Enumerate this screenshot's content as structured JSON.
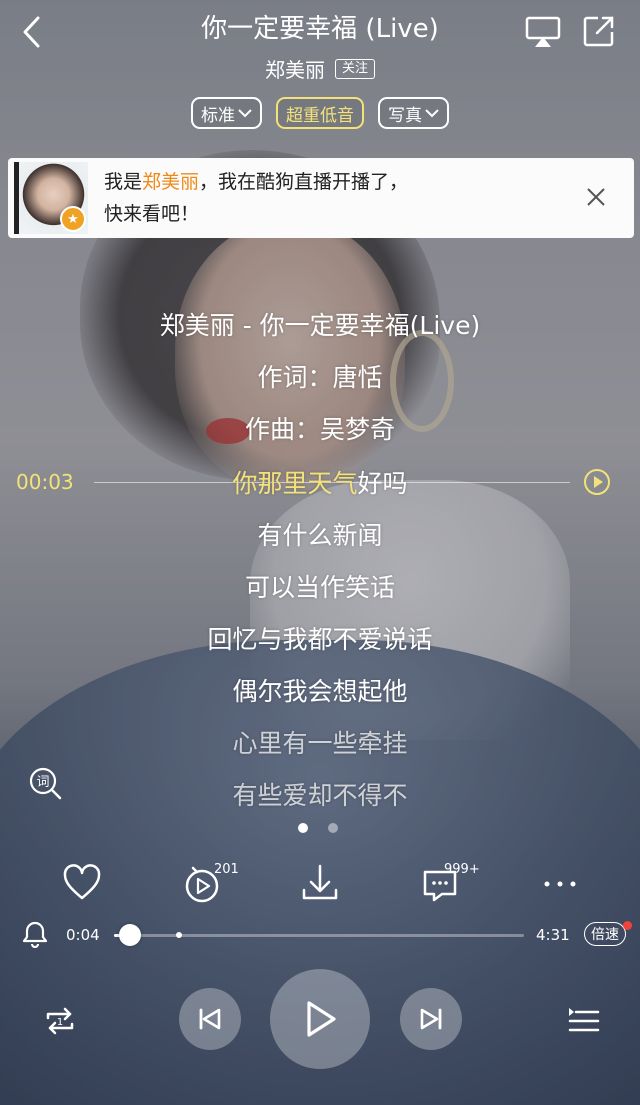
{
  "header": {
    "title": "你一定要幸福 (Live)",
    "artist": "郑美丽",
    "follow_label": "关注",
    "back_icon": "chevron-left-icon",
    "cast_icon": "airplay-icon",
    "share_icon": "share-icon"
  },
  "pills": [
    {
      "label": "标准",
      "active": false
    },
    {
      "label": "超重低音",
      "active": true
    },
    {
      "label": "写真",
      "active": false
    }
  ],
  "banner": {
    "prefix": "我是",
    "highlight": "郑美丽",
    "line1_suffix": "，我在酷狗直播开播了，",
    "line2": "快来看吧！"
  },
  "lyrics": {
    "current_time": "00:03",
    "lines": [
      "郑美丽 - 你一定要幸福(Live)",
      "作词：唐恬",
      "作曲：吴梦奇",
      "你那里天气好吗",
      "有什么新闻",
      "可以当作笑话",
      "回忆与我都不爱说话",
      "偶尔我会想起他",
      "心里有一些牵挂",
      "有些爱却不得不"
    ],
    "current_sung": "你那里天气",
    "current_rest": "好吗"
  },
  "pager": {
    "pages": 2,
    "current": 1
  },
  "actions": {
    "like_icon": "heart-icon",
    "mv_count": "201",
    "download_icon": "download-icon",
    "comment_count": "999+",
    "more_icon": "more-icon"
  },
  "progress": {
    "current": "0:04",
    "total": "4:31",
    "fraction": 0.04,
    "speed_label": "倍速"
  },
  "colors": {
    "accent": "#f3e27a",
    "banner_highlight": "#ef8a19",
    "badge_red": "#f0433a"
  }
}
